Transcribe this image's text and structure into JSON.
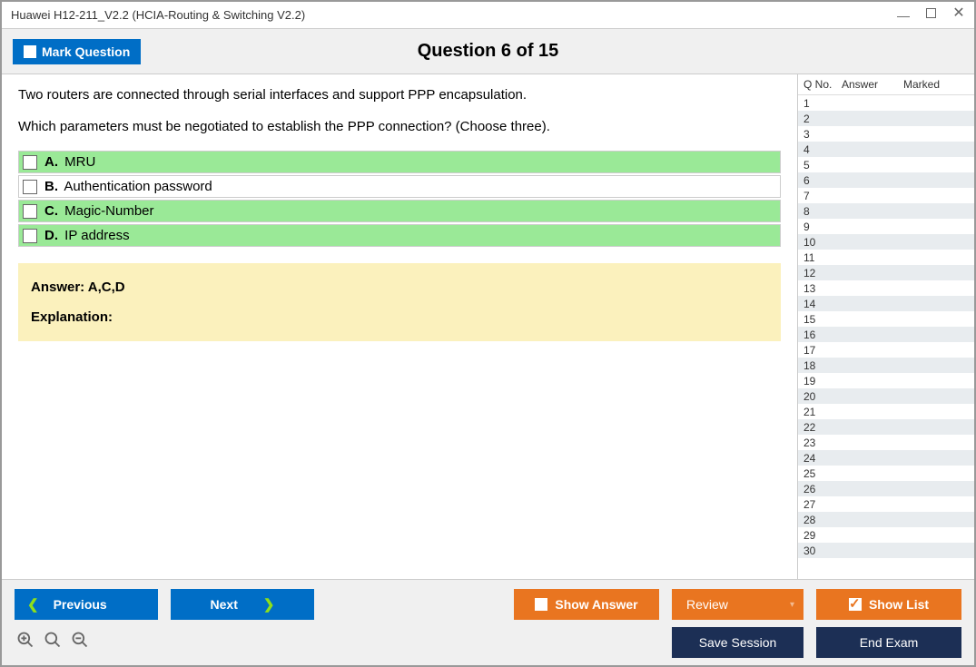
{
  "window": {
    "title": "Huawei H12-211_V2.2 (HCIA-Routing & Switching V2.2)"
  },
  "header": {
    "mark_label": "Mark Question",
    "question_title": "Question 6 of 15"
  },
  "question": {
    "line1": "Two routers are connected through serial interfaces and support PPP encapsulation.",
    "line2": "Which parameters must be negotiated to establish the PPP connection? (Choose three)."
  },
  "options": [
    {
      "letter": "A.",
      "text": "MRU",
      "correct": true
    },
    {
      "letter": "B.",
      "text": "Authentication password",
      "correct": false
    },
    {
      "letter": "C.",
      "text": "Magic-Number",
      "correct": true
    },
    {
      "letter": "D.",
      "text": "IP address",
      "correct": true
    }
  ],
  "answer_panel": {
    "answer_label": "Answer: A,C,D",
    "explanation_label": "Explanation:"
  },
  "sidebar": {
    "col_qno": "Q No.",
    "col_answer": "Answer",
    "col_marked": "Marked",
    "rows": 30
  },
  "footer": {
    "previous": "Previous",
    "next": "Next",
    "show_answer": "Show Answer",
    "review": "Review",
    "show_list": "Show List",
    "save_session": "Save Session",
    "end_exam": "End Exam"
  }
}
